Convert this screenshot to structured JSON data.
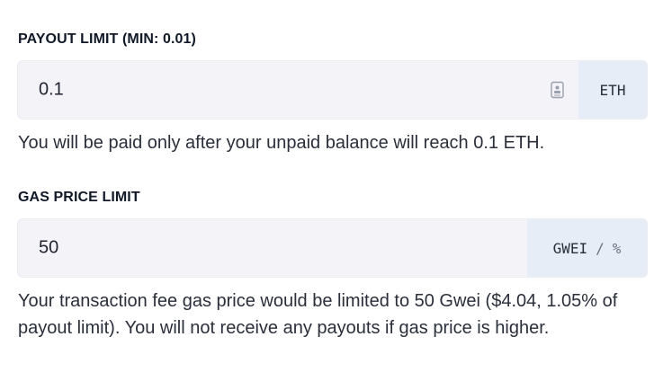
{
  "payout": {
    "label": "PAYOUT LIMIT (MIN: 0.01)",
    "value": "0.1",
    "unit": "ETH",
    "help": "You will be paid only after your unpaid balance will reach 0.1 ETH.",
    "icon": "autofill-icon"
  },
  "gas": {
    "label": "GAS PRICE LIMIT",
    "value": "50",
    "unit_main": "GWEI",
    "unit_sep": "/",
    "unit_alt": "%",
    "help": "Your transaction fee gas price would be limited to 50 Gwei ($4.04, 1.05% of payout limit). You will not receive any payouts if gas price is higher."
  },
  "colors": {
    "field_bg": "#f4f3f8",
    "unit_bg": "#e6edf6",
    "text": "#1f2330"
  }
}
